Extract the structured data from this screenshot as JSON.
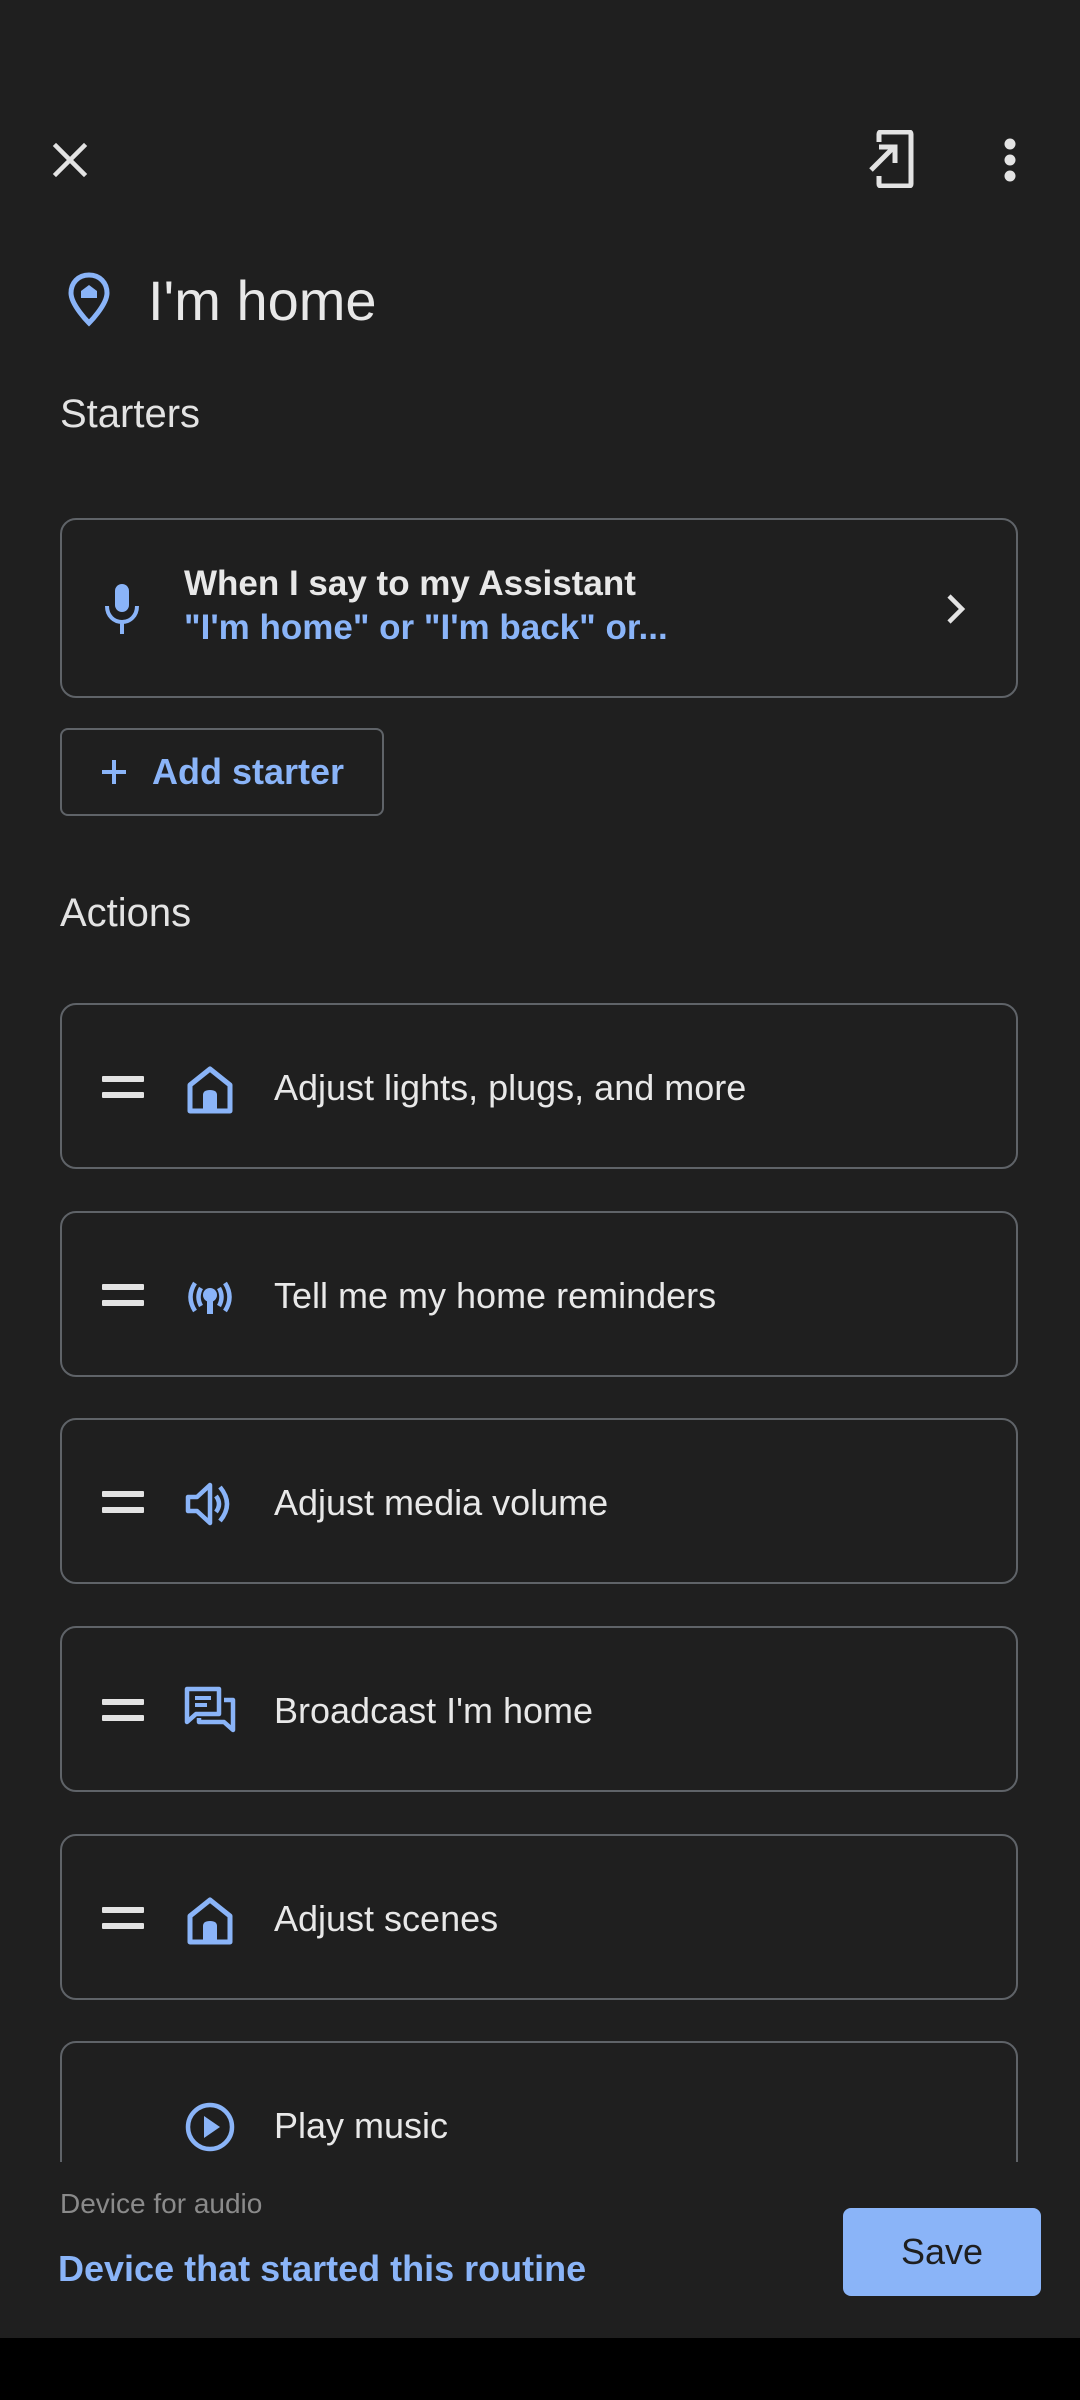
{
  "header": {
    "close_icon": "close-icon",
    "share_icon": "add-to-home-screen-icon",
    "more_icon": "more-vert-icon"
  },
  "title": {
    "icon": "location-pin-icon",
    "text": "I'm home"
  },
  "starters": {
    "section_label": "Starters",
    "card": {
      "icon": "microphone-icon",
      "title": "When I say to my Assistant",
      "subtitle": "\"I'm home\" or \"I'm back\" or..."
    },
    "add_label": "Add starter"
  },
  "actions": {
    "section_label": "Actions",
    "items": [
      {
        "icon": "home-icon",
        "label": "Adjust lights, plugs, and more"
      },
      {
        "icon": "broadcast-reminder-icon",
        "label": "Tell me my home reminders"
      },
      {
        "icon": "volume-icon",
        "label": "Adjust media volume"
      },
      {
        "icon": "broadcast-chat-icon",
        "label": "Broadcast I'm home"
      },
      {
        "icon": "home-icon",
        "label": "Adjust scenes"
      },
      {
        "icon": "play-circle-icon",
        "label": "Play music"
      }
    ]
  },
  "footer": {
    "device_label": "Device for audio",
    "device_value": "Device that started this routine",
    "save_label": "Save"
  },
  "colors": {
    "background": "#1f1f1f",
    "accent": "#8ab4f8",
    "border": "#5f6368",
    "text": "#e8e8e8"
  }
}
